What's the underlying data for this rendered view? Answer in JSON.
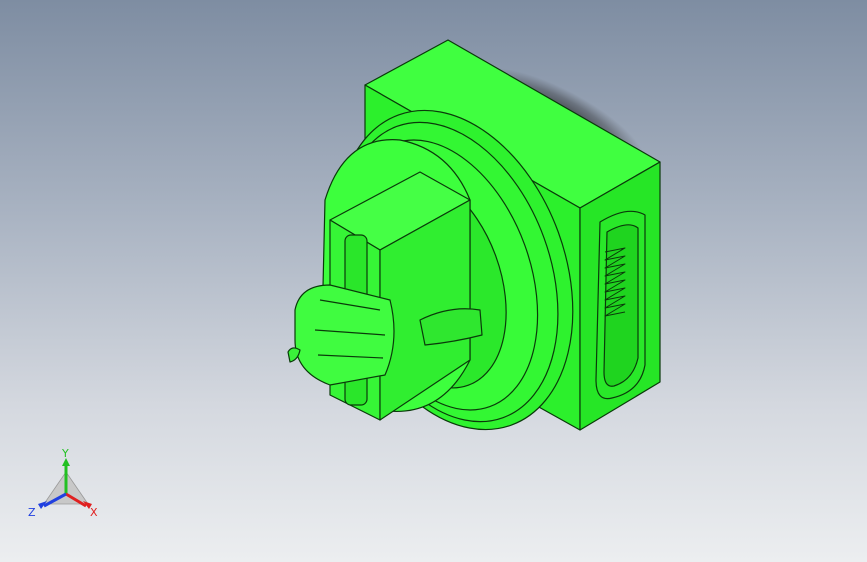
{
  "viewport": {
    "background_top": "#7e8da2",
    "background_bottom": "#eceef0"
  },
  "model": {
    "body_color": "#33ff33",
    "edge_color": "#0a3a0a",
    "shadow_color": "#1a1a1a"
  },
  "triad": {
    "x_label": "X",
    "y_label": "Y",
    "z_label": "Z",
    "x_color": "#e02020",
    "y_color": "#22c022",
    "z_color": "#2040e0"
  }
}
